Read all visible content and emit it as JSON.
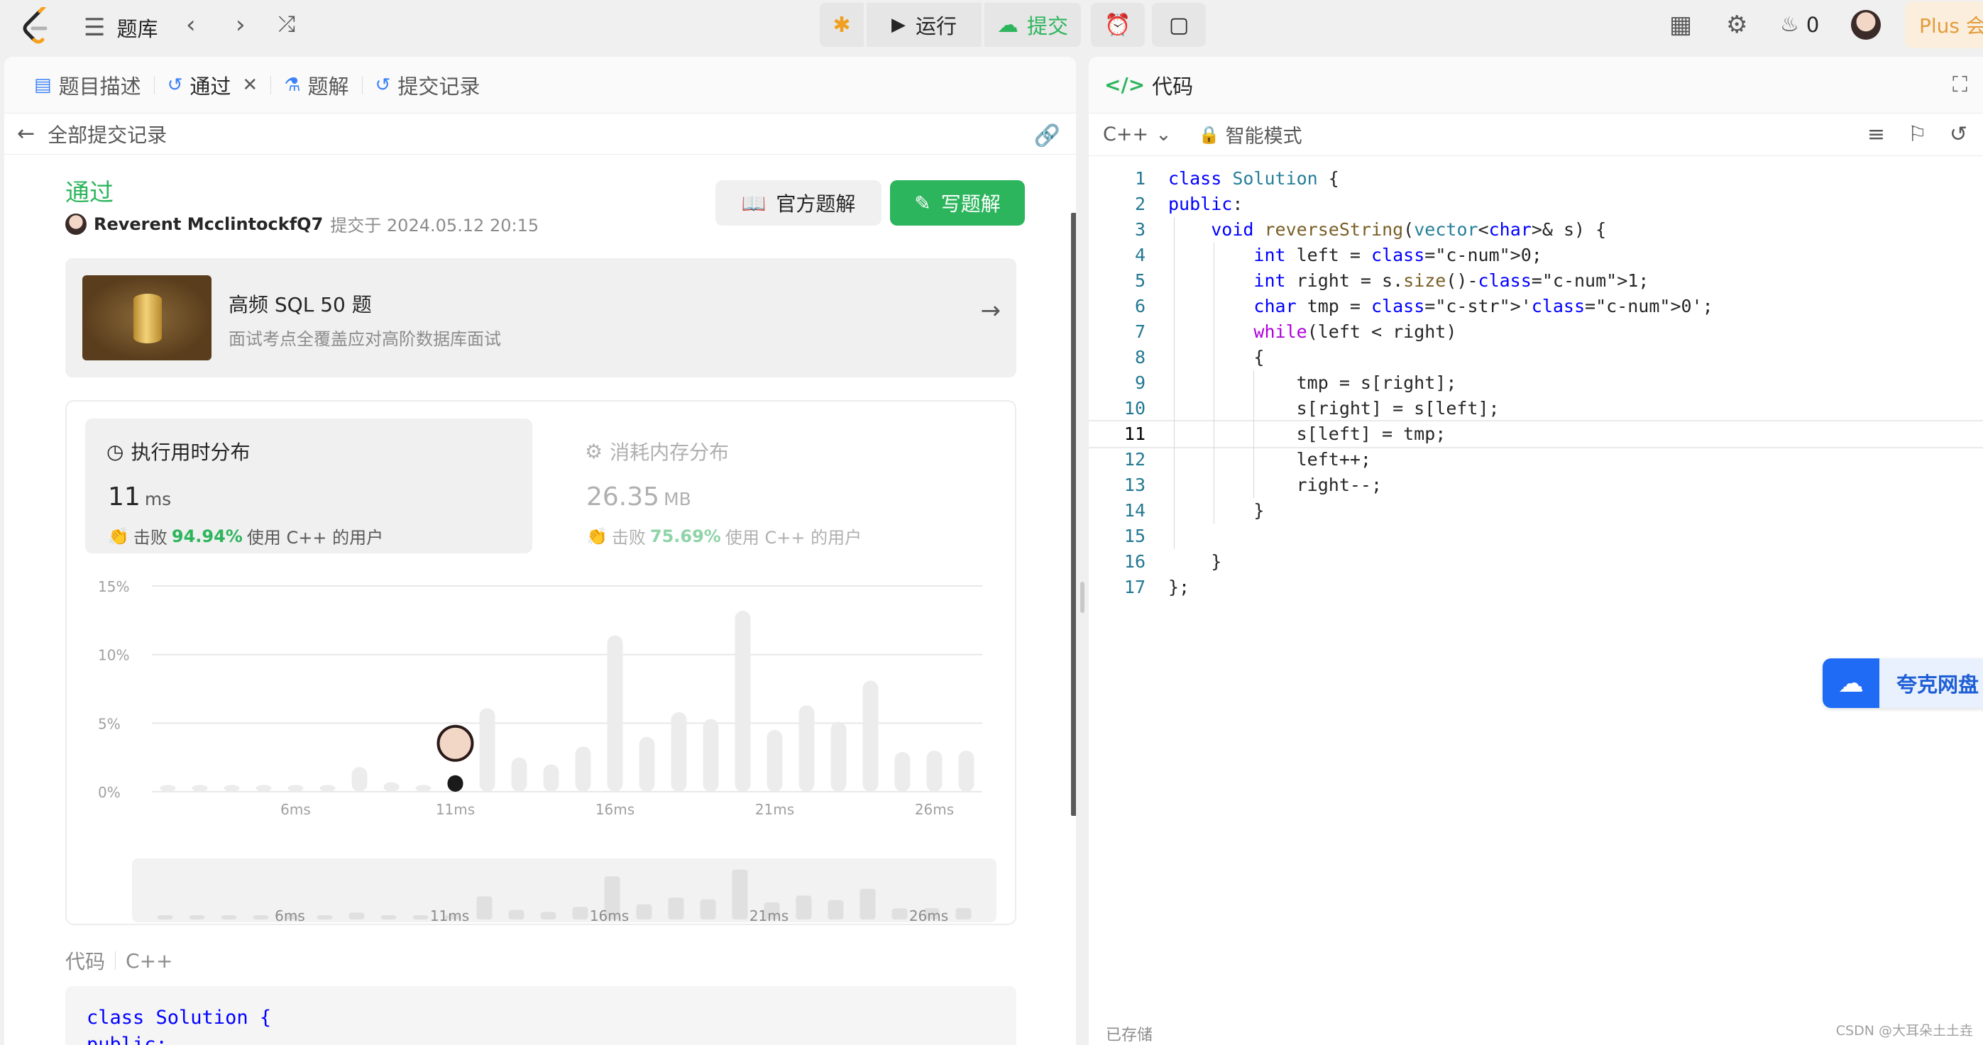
{
  "topbar": {
    "problem_list_label": "题库",
    "run_label": "运行",
    "submit_label": "提交",
    "streak_count": "0",
    "plus_label": "Plus 会"
  },
  "tabs": [
    {
      "label": "题目描述"
    },
    {
      "label": "通过"
    },
    {
      "label": "题解"
    },
    {
      "label": "提交记录"
    }
  ],
  "back_label": "全部提交记录",
  "result": {
    "status": "通过",
    "user": "Reverent McclintockfQ7",
    "submitted_at": "提交于 2024.05.12 20:15",
    "official_solution_label": "官方题解",
    "write_solution_label": "写题解"
  },
  "promo": {
    "title": "高频 SQL 50 题",
    "subtitle": "面试考点全覆盖应对高阶数据库面试"
  },
  "runtime": {
    "title": "执行用时分布",
    "value": "11",
    "unit": "ms",
    "beat_prefix": "击败",
    "beat_pct": "94.94%",
    "beat_suffix": "使用 C++ 的用户"
  },
  "memory": {
    "title": "消耗内存分布",
    "value": "26.35",
    "unit": "MB",
    "beat_prefix": "击败",
    "beat_pct": "75.69%",
    "beat_suffix": "使用 C++ 的用户"
  },
  "chart_data": {
    "type": "bar",
    "y_ticks": [
      "15%",
      "10%",
      "5%",
      "0%"
    ],
    "x_tick_labels": [
      "6ms",
      "11ms",
      "16ms",
      "21ms",
      "26ms"
    ],
    "ylim": [
      0,
      15
    ],
    "categories_ms": [
      2,
      3,
      4,
      5,
      6,
      7,
      8,
      9,
      10,
      11,
      12,
      13,
      14,
      15,
      16,
      17,
      18,
      19,
      20,
      21,
      22,
      23,
      24,
      25,
      26,
      27
    ],
    "values": [
      0.5,
      0.5,
      0.5,
      0.5,
      0.5,
      0.5,
      1.8,
      0.7,
      0.5,
      1.2,
      6.1,
      2.5,
      2.0,
      3.3,
      11.4,
      4.0,
      5.8,
      5.3,
      13.2,
      4.5,
      6.3,
      5.1,
      8.1,
      2.9,
      3.0,
      3.0
    ],
    "highlight_ms": 11,
    "grid": true
  },
  "code_section": {
    "label": "代码",
    "lang": "C++",
    "lines": [
      "class Solution {",
      "public:"
    ]
  },
  "editor": {
    "title": "代码",
    "language": "C++",
    "mode": "智能模式",
    "current_line": 11,
    "lines": [
      "class Solution {",
      "public:",
      "    void reverseString(vector<char>& s) {",
      "        int left = 0;",
      "        int right = s.size()-1;",
      "        char tmp = '0';",
      "        while(left < right)",
      "        {",
      "            tmp = s[right];",
      "            s[right] = s[left];",
      "            s[left] = tmp;",
      "            left++;",
      "            right--;",
      "        }",
      "",
      "    }",
      "};"
    ],
    "saved_label": "已存储",
    "watermark": "CSDN @大耳朵土土垚"
  },
  "cloud_drive": {
    "label": "夸克网盘"
  },
  "colors": {
    "accent_green": "#2db55d",
    "bar_gray": "#ececec",
    "bar_highlight": "#1a1a1a"
  }
}
